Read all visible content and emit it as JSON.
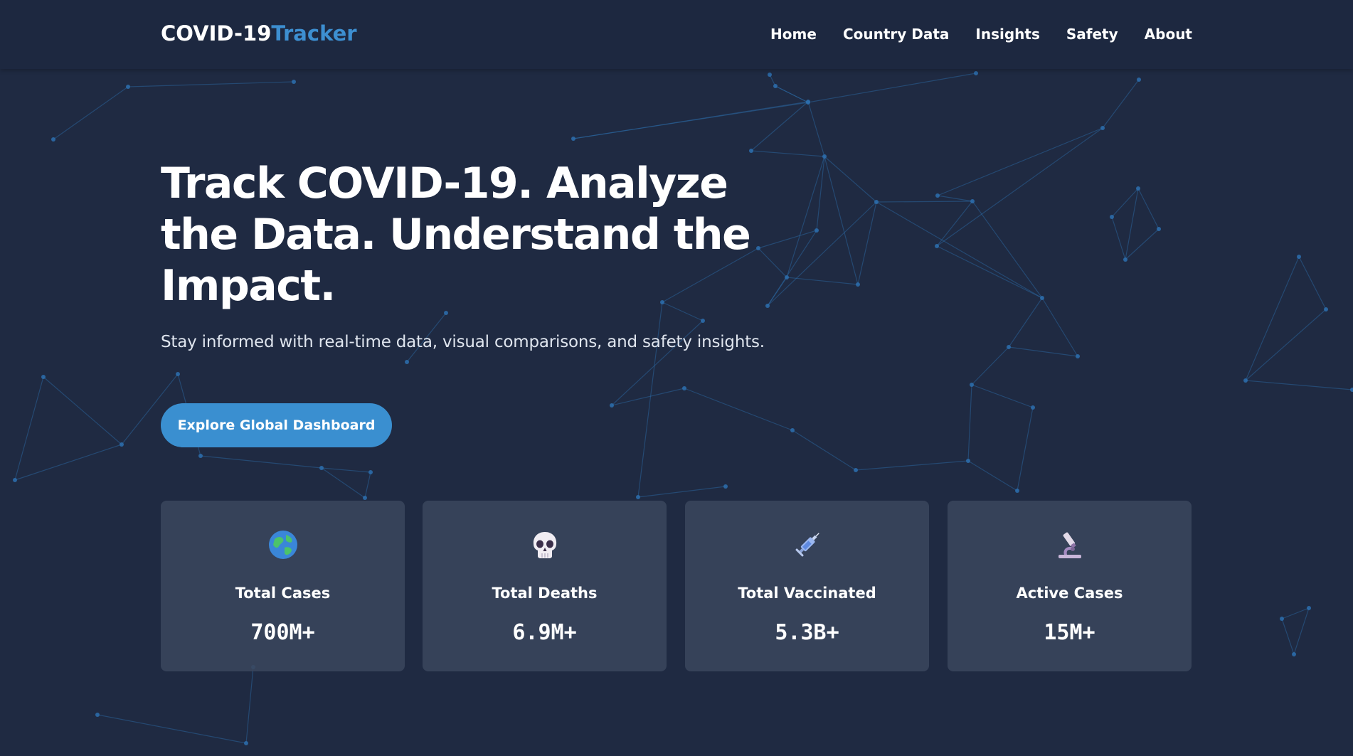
{
  "brand": {
    "name_main": "COVID-19",
    "name_accent": "Tracker"
  },
  "nav": [
    {
      "label": "Home"
    },
    {
      "label": "Country Data"
    },
    {
      "label": "Insights"
    },
    {
      "label": "Safety"
    },
    {
      "label": "About"
    }
  ],
  "hero": {
    "title_line1": "Track COVID-19. Analyze",
    "title_line2": "the Data. Understand the",
    "title_line3": "Impact.",
    "subtitle": "Stay informed with real-time data, visual comparisons, and safety insights.",
    "cta_label": "Explore Global Dashboard"
  },
  "stats": [
    {
      "icon": "globe-icon",
      "label": "Total Cases",
      "value": "700M+"
    },
    {
      "icon": "skull-icon",
      "label": "Total Deaths",
      "value": "6.9M+"
    },
    {
      "icon": "syringe-icon",
      "label": "Total Vaccinated",
      "value": "5.3B+"
    },
    {
      "icon": "microscope-icon",
      "label": "Active Cases",
      "value": "15M+"
    }
  ],
  "colors": {
    "background": "#1f2a42",
    "navbar": "#1d2840",
    "accent": "#3a8fd0",
    "card": "#3a465c",
    "network": "#2d6fae"
  }
}
